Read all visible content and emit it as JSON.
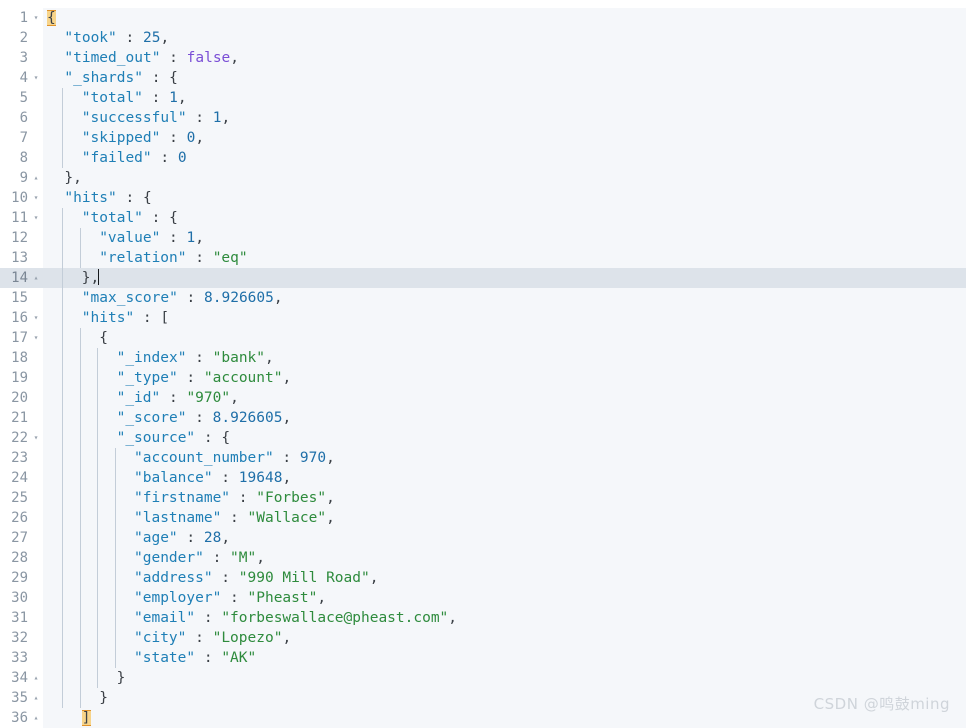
{
  "editor": {
    "background": "#f5f7fa",
    "gutter_background": "#ffffff",
    "active_line_number": 14,
    "active_line_background": "#dde3ea",
    "colors": {
      "key": "#1f7fb6",
      "string": "#2e8b3d",
      "number": "#1f6fa8",
      "boolean": "#7a4fd6",
      "punctuation": "#3a3f45",
      "line_number": "#8a96a3",
      "indent_guide": "#c3cdd8",
      "bracket_match_highlight": "#f7d48a"
    },
    "fold_open_glyph": "▾",
    "fold_close_glyph": "▴"
  },
  "lines": [
    {
      "num": "1",
      "fold": "▾",
      "indent": 0,
      "caret": false,
      "tokens": [
        {
          "t": "{",
          "c": "br-match"
        }
      ]
    },
    {
      "num": "2",
      "fold": "",
      "indent": 1,
      "caret": false,
      "tokens": [
        {
          "t": "\"took\"",
          "c": "k"
        },
        {
          "t": " : ",
          "c": "p"
        },
        {
          "t": "25",
          "c": "n"
        },
        {
          "t": ",",
          "c": "p"
        }
      ]
    },
    {
      "num": "3",
      "fold": "",
      "indent": 1,
      "caret": false,
      "tokens": [
        {
          "t": "\"timed_out\"",
          "c": "k"
        },
        {
          "t": " : ",
          "c": "p"
        },
        {
          "t": "false",
          "c": "b"
        },
        {
          "t": ",",
          "c": "p"
        }
      ]
    },
    {
      "num": "4",
      "fold": "▾",
      "indent": 1,
      "caret": false,
      "tokens": [
        {
          "t": "\"_shards\"",
          "c": "k"
        },
        {
          "t": " : ",
          "c": "p"
        },
        {
          "t": "{",
          "c": "br"
        }
      ]
    },
    {
      "num": "5",
      "fold": "",
      "indent": 2,
      "caret": false,
      "tokens": [
        {
          "t": "\"total\"",
          "c": "k"
        },
        {
          "t": " : ",
          "c": "p"
        },
        {
          "t": "1",
          "c": "n"
        },
        {
          "t": ",",
          "c": "p"
        }
      ]
    },
    {
      "num": "6",
      "fold": "",
      "indent": 2,
      "caret": false,
      "tokens": [
        {
          "t": "\"successful\"",
          "c": "k"
        },
        {
          "t": " : ",
          "c": "p"
        },
        {
          "t": "1",
          "c": "n"
        },
        {
          "t": ",",
          "c": "p"
        }
      ]
    },
    {
      "num": "7",
      "fold": "",
      "indent": 2,
      "caret": false,
      "tokens": [
        {
          "t": "\"skipped\"",
          "c": "k"
        },
        {
          "t": " : ",
          "c": "p"
        },
        {
          "t": "0",
          "c": "n"
        },
        {
          "t": ",",
          "c": "p"
        }
      ]
    },
    {
      "num": "8",
      "fold": "",
      "indent": 2,
      "caret": false,
      "tokens": [
        {
          "t": "\"failed\"",
          "c": "k"
        },
        {
          "t": " : ",
          "c": "p"
        },
        {
          "t": "0",
          "c": "n"
        }
      ]
    },
    {
      "num": "9",
      "fold": "▴",
      "indent": 1,
      "caret": false,
      "tokens": [
        {
          "t": "}",
          "c": "br"
        },
        {
          "t": ",",
          "c": "p"
        }
      ]
    },
    {
      "num": "10",
      "fold": "▾",
      "indent": 1,
      "caret": false,
      "tokens": [
        {
          "t": "\"hits\"",
          "c": "k"
        },
        {
          "t": " : ",
          "c": "p"
        },
        {
          "t": "{",
          "c": "br"
        }
      ]
    },
    {
      "num": "11",
      "fold": "▾",
      "indent": 2,
      "caret": false,
      "tokens": [
        {
          "t": "\"total\"",
          "c": "k"
        },
        {
          "t": " : ",
          "c": "p"
        },
        {
          "t": "{",
          "c": "br"
        }
      ]
    },
    {
      "num": "12",
      "fold": "",
      "indent": 3,
      "caret": false,
      "tokens": [
        {
          "t": "\"value\"",
          "c": "k"
        },
        {
          "t": " : ",
          "c": "p"
        },
        {
          "t": "1",
          "c": "n"
        },
        {
          "t": ",",
          "c": "p"
        }
      ]
    },
    {
      "num": "13",
      "fold": "",
      "indent": 3,
      "caret": false,
      "tokens": [
        {
          "t": "\"relation\"",
          "c": "k"
        },
        {
          "t": " : ",
          "c": "p"
        },
        {
          "t": "\"eq\"",
          "c": "s"
        }
      ]
    },
    {
      "num": "14",
      "fold": "▴",
      "indent": 2,
      "caret": true,
      "tokens": [
        {
          "t": "}",
          "c": "br"
        },
        {
          "t": ",",
          "c": "p"
        }
      ]
    },
    {
      "num": "15",
      "fold": "",
      "indent": 2,
      "caret": false,
      "tokens": [
        {
          "t": "\"max_score\"",
          "c": "k"
        },
        {
          "t": " : ",
          "c": "p"
        },
        {
          "t": "8.926605",
          "c": "n"
        },
        {
          "t": ",",
          "c": "p"
        }
      ]
    },
    {
      "num": "16",
      "fold": "▾",
      "indent": 2,
      "caret": false,
      "tokens": [
        {
          "t": "\"hits\"",
          "c": "k"
        },
        {
          "t": " : ",
          "c": "p"
        },
        {
          "t": "[",
          "c": "br"
        }
      ]
    },
    {
      "num": "17",
      "fold": "▾",
      "indent": 3,
      "caret": false,
      "tokens": [
        {
          "t": "{",
          "c": "br"
        }
      ]
    },
    {
      "num": "18",
      "fold": "",
      "indent": 4,
      "caret": false,
      "tokens": [
        {
          "t": "\"_index\"",
          "c": "k"
        },
        {
          "t": " : ",
          "c": "p"
        },
        {
          "t": "\"bank\"",
          "c": "s"
        },
        {
          "t": ",",
          "c": "p"
        }
      ]
    },
    {
      "num": "19",
      "fold": "",
      "indent": 4,
      "caret": false,
      "tokens": [
        {
          "t": "\"_type\"",
          "c": "k"
        },
        {
          "t": " : ",
          "c": "p"
        },
        {
          "t": "\"account\"",
          "c": "s"
        },
        {
          "t": ",",
          "c": "p"
        }
      ]
    },
    {
      "num": "20",
      "fold": "",
      "indent": 4,
      "caret": false,
      "tokens": [
        {
          "t": "\"_id\"",
          "c": "k"
        },
        {
          "t": " : ",
          "c": "p"
        },
        {
          "t": "\"970\"",
          "c": "s"
        },
        {
          "t": ",",
          "c": "p"
        }
      ]
    },
    {
      "num": "21",
      "fold": "",
      "indent": 4,
      "caret": false,
      "tokens": [
        {
          "t": "\"_score\"",
          "c": "k"
        },
        {
          "t": " : ",
          "c": "p"
        },
        {
          "t": "8.926605",
          "c": "n"
        },
        {
          "t": ",",
          "c": "p"
        }
      ]
    },
    {
      "num": "22",
      "fold": "▾",
      "indent": 4,
      "caret": false,
      "tokens": [
        {
          "t": "\"_source\"",
          "c": "k"
        },
        {
          "t": " : ",
          "c": "p"
        },
        {
          "t": "{",
          "c": "br"
        }
      ]
    },
    {
      "num": "23",
      "fold": "",
      "indent": 5,
      "caret": false,
      "tokens": [
        {
          "t": "\"account_number\"",
          "c": "k"
        },
        {
          "t": " : ",
          "c": "p"
        },
        {
          "t": "970",
          "c": "n"
        },
        {
          "t": ",",
          "c": "p"
        }
      ]
    },
    {
      "num": "24",
      "fold": "",
      "indent": 5,
      "caret": false,
      "tokens": [
        {
          "t": "\"balance\"",
          "c": "k"
        },
        {
          "t": " : ",
          "c": "p"
        },
        {
          "t": "19648",
          "c": "n"
        },
        {
          "t": ",",
          "c": "p"
        }
      ]
    },
    {
      "num": "25",
      "fold": "",
      "indent": 5,
      "caret": false,
      "tokens": [
        {
          "t": "\"firstname\"",
          "c": "k"
        },
        {
          "t": " : ",
          "c": "p"
        },
        {
          "t": "\"Forbes\"",
          "c": "s"
        },
        {
          "t": ",",
          "c": "p"
        }
      ]
    },
    {
      "num": "26",
      "fold": "",
      "indent": 5,
      "caret": false,
      "tokens": [
        {
          "t": "\"lastname\"",
          "c": "k"
        },
        {
          "t": " : ",
          "c": "p"
        },
        {
          "t": "\"Wallace\"",
          "c": "s"
        },
        {
          "t": ",",
          "c": "p"
        }
      ]
    },
    {
      "num": "27",
      "fold": "",
      "indent": 5,
      "caret": false,
      "tokens": [
        {
          "t": "\"age\"",
          "c": "k"
        },
        {
          "t": " : ",
          "c": "p"
        },
        {
          "t": "28",
          "c": "n"
        },
        {
          "t": ",",
          "c": "p"
        }
      ]
    },
    {
      "num": "28",
      "fold": "",
      "indent": 5,
      "caret": false,
      "tokens": [
        {
          "t": "\"gender\"",
          "c": "k"
        },
        {
          "t": " : ",
          "c": "p"
        },
        {
          "t": "\"M\"",
          "c": "s"
        },
        {
          "t": ",",
          "c": "p"
        }
      ]
    },
    {
      "num": "29",
      "fold": "",
      "indent": 5,
      "caret": false,
      "tokens": [
        {
          "t": "\"address\"",
          "c": "k"
        },
        {
          "t": " : ",
          "c": "p"
        },
        {
          "t": "\"990 Mill Road\"",
          "c": "s"
        },
        {
          "t": ",",
          "c": "p"
        }
      ]
    },
    {
      "num": "30",
      "fold": "",
      "indent": 5,
      "caret": false,
      "tokens": [
        {
          "t": "\"employer\"",
          "c": "k"
        },
        {
          "t": " : ",
          "c": "p"
        },
        {
          "t": "\"Pheast\"",
          "c": "s"
        },
        {
          "t": ",",
          "c": "p"
        }
      ]
    },
    {
      "num": "31",
      "fold": "",
      "indent": 5,
      "caret": false,
      "tokens": [
        {
          "t": "\"email\"",
          "c": "k"
        },
        {
          "t": " : ",
          "c": "p"
        },
        {
          "t": "\"forbeswallace@pheast.com\"",
          "c": "s"
        },
        {
          "t": ",",
          "c": "p"
        }
      ]
    },
    {
      "num": "32",
      "fold": "",
      "indent": 5,
      "caret": false,
      "tokens": [
        {
          "t": "\"city\"",
          "c": "k"
        },
        {
          "t": " : ",
          "c": "p"
        },
        {
          "t": "\"Lopezo\"",
          "c": "s"
        },
        {
          "t": ",",
          "c": "p"
        }
      ]
    },
    {
      "num": "33",
      "fold": "",
      "indent": 5,
      "caret": false,
      "tokens": [
        {
          "t": "\"state\"",
          "c": "k"
        },
        {
          "t": " : ",
          "c": "p"
        },
        {
          "t": "\"AK\"",
          "c": "s"
        }
      ]
    },
    {
      "num": "34",
      "fold": "▴",
      "indent": 4,
      "caret": false,
      "tokens": [
        {
          "t": "}",
          "c": "br"
        }
      ]
    },
    {
      "num": "35",
      "fold": "▴",
      "indent": 3,
      "caret": false,
      "tokens": [
        {
          "t": "}",
          "c": "br"
        }
      ]
    },
    {
      "num": "36",
      "fold": "▴",
      "indent": 2,
      "caret": false,
      "tokens": [
        {
          "t": "]",
          "c": "br-match"
        }
      ]
    }
  ],
  "indent_guides": [
    {
      "indent": 1,
      "from": 5,
      "to": 8
    },
    {
      "indent": 1,
      "from": 11,
      "to": 35
    },
    {
      "indent": 2,
      "from": 12,
      "to": 13
    },
    {
      "indent": 2,
      "from": 17,
      "to": 35
    },
    {
      "indent": 3,
      "from": 18,
      "to": 34
    },
    {
      "indent": 4,
      "from": 23,
      "to": 33
    }
  ],
  "watermark": {
    "text": "CSDN @鸣鼓ming"
  }
}
